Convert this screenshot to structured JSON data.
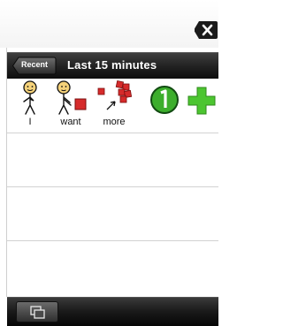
{
  "nav": {
    "back_label": "Recent",
    "title": "Last 15 minutes"
  },
  "sentence": {
    "symbols": [
      {
        "label": "I",
        "icon": "person-pointing-self-icon"
      },
      {
        "label": "want",
        "icon": "person-reaching-cube-icon"
      },
      {
        "label": "more",
        "icon": "more-cubes-icon"
      },
      {
        "label": "",
        "icon": "number-one-circle-icon"
      },
      {
        "label": "",
        "icon": "plus-icon"
      }
    ]
  },
  "colors": {
    "accent_green": "#3cae2c",
    "cube_red": "#d62b2b"
  }
}
